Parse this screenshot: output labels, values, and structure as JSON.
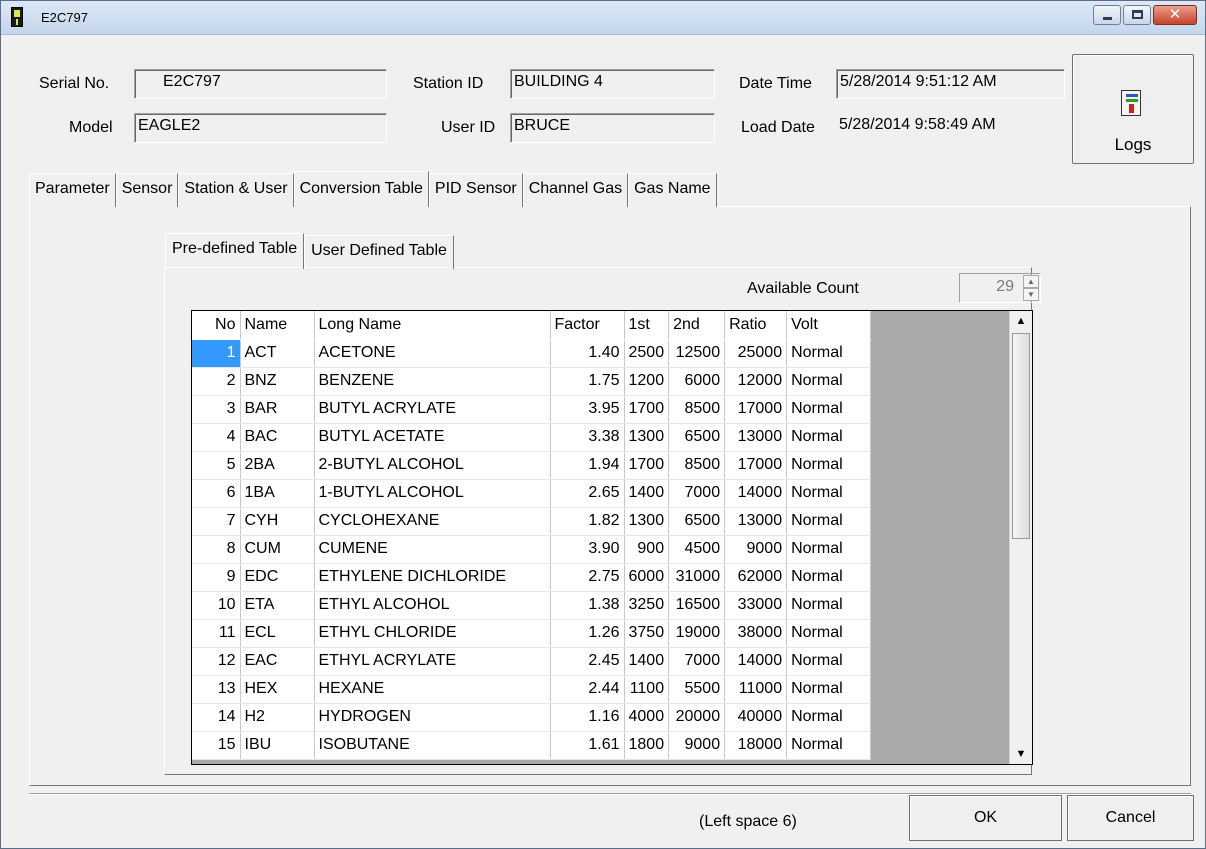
{
  "window": {
    "title": "E2C797"
  },
  "header": {
    "serial_label": "Serial No.",
    "serial_value": "E2C797",
    "model_label": "Model",
    "model_value": "EAGLE2",
    "station_label": "Station ID",
    "station_value": "BUILDING 4",
    "user_label": "User ID",
    "user_value": "BRUCE",
    "datetime_label": "Date Time",
    "datetime_value": "5/28/2014 9:51:12 AM",
    "loaddate_label": "Load Date",
    "loaddate_value": "5/28/2014 9:58:49 AM",
    "logs_label": "Logs"
  },
  "tabs": [
    "Parameter",
    "Sensor",
    "Station & User",
    "Conversion Table",
    "PID Sensor",
    "Channel Gas",
    "Gas Name"
  ],
  "active_tab": "Conversion Table",
  "subtabs": [
    "Pre-defined Table",
    "User Defined Table"
  ],
  "active_subtab": "Pre-defined Table",
  "available": {
    "label": "Available Count",
    "value": "29"
  },
  "table": {
    "columns": [
      "No",
      "Name",
      "Long Name",
      "Factor",
      "1st",
      "2nd",
      "Ratio",
      "Volt"
    ],
    "rows": [
      [
        "1",
        "ACT",
        "ACETONE",
        "1.40",
        "2500",
        "12500",
        "25000",
        "Normal"
      ],
      [
        "2",
        "BNZ",
        "BENZENE",
        "1.75",
        "1200",
        "6000",
        "12000",
        "Normal"
      ],
      [
        "3",
        "BAR",
        "BUTYL ACRYLATE",
        "3.95",
        "1700",
        "8500",
        "17000",
        "Normal"
      ],
      [
        "4",
        "BAC",
        "BUTYL ACETATE",
        "3.38",
        "1300",
        "6500",
        "13000",
        "Normal"
      ],
      [
        "5",
        "2BA",
        "2-BUTYL ALCOHOL",
        "1.94",
        "1700",
        "8500",
        "17000",
        "Normal"
      ],
      [
        "6",
        "1BA",
        "1-BUTYL ALCOHOL",
        "2.65",
        "1400",
        "7000",
        "14000",
        "Normal"
      ],
      [
        "7",
        "CYH",
        "CYCLOHEXANE",
        "1.82",
        "1300",
        "6500",
        "13000",
        "Normal"
      ],
      [
        "8",
        "CUM",
        "CUMENE",
        "3.90",
        "900",
        "4500",
        "9000",
        "Normal"
      ],
      [
        "9",
        "EDC",
        "ETHYLENE DICHLORIDE",
        "2.75",
        "6000",
        "31000",
        "62000",
        "Normal"
      ],
      [
        "10",
        "ETA",
        "ETHYL ALCOHOL",
        "1.38",
        "3250",
        "16500",
        "33000",
        "Normal"
      ],
      [
        "11",
        "ECL",
        "ETHYL CHLORIDE",
        "1.26",
        "3750",
        "19000",
        "38000",
        "Normal"
      ],
      [
        "12",
        "EAC",
        "ETHYL ACRYLATE",
        "2.45",
        "1400",
        "7000",
        "14000",
        "Normal"
      ],
      [
        "13",
        "HEX",
        "HEXANE",
        "2.44",
        "1100",
        "5500",
        "11000",
        "Normal"
      ],
      [
        "14",
        "H2",
        "HYDROGEN",
        "1.16",
        "4000",
        "20000",
        "40000",
        "Normal"
      ],
      [
        "15",
        "IBU",
        "ISOBUTANE",
        "1.61",
        "1800",
        "9000",
        "18000",
        "Normal"
      ]
    ]
  },
  "footer": {
    "status": "(Left space 6)",
    "ok_label": "OK",
    "cancel_label": "Cancel"
  },
  "colors": {
    "selection": "#3399ff",
    "titlebar": "#c4d6ec",
    "close_button": "#c6412a"
  }
}
